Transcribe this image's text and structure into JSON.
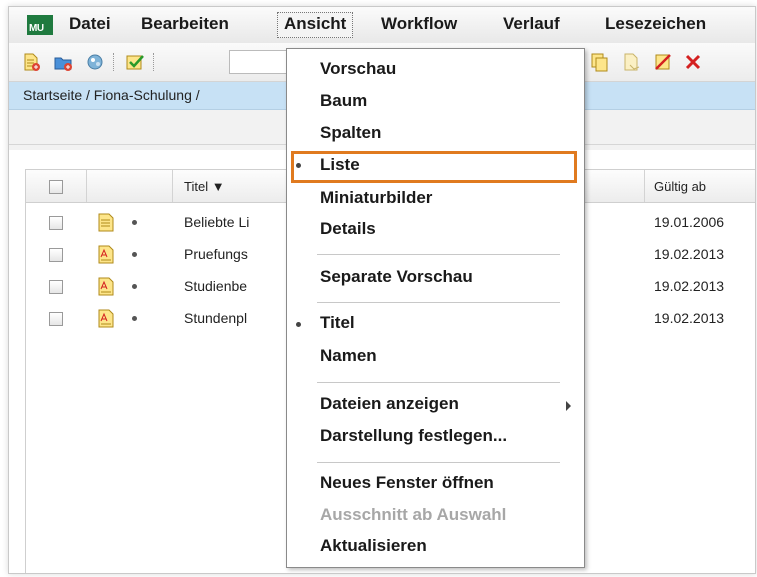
{
  "menubar": {
    "logo": "MU",
    "items": [
      "Datei",
      "Bearbeiten",
      "Ansicht",
      "Workflow",
      "Verlauf",
      "Lesezeichen"
    ]
  },
  "breadcrumb": "Startseite / Fiona-Schulung /",
  "table": {
    "columns": {
      "title": "Titel ▼",
      "valid_from": "Gültig ab"
    },
    "rows": [
      {
        "title": "Beliebte Li",
        "date": "19.01.2006"
      },
      {
        "title": "Pruefungs",
        "date": "19.02.2013"
      },
      {
        "title": "Studienbe",
        "date": "19.02.2013"
      },
      {
        "title": "Stundenpl",
        "date": "19.02.2013"
      }
    ]
  },
  "dropdown": {
    "items": [
      {
        "label": "Vorschau"
      },
      {
        "label": "Baum"
      },
      {
        "label": "Spalten"
      },
      {
        "label": "Liste",
        "selected": true
      },
      {
        "label": "Miniaturbilder"
      },
      {
        "label": "Details"
      },
      {
        "label": "Separate Vorschau"
      },
      {
        "label": "Titel",
        "selected": true
      },
      {
        "label": "Namen"
      },
      {
        "label": "Dateien anzeigen",
        "submenu": true
      },
      {
        "label": "Darstellung festlegen..."
      },
      {
        "label": "Neues Fenster öffnen"
      },
      {
        "label": "Ausschnitt ab Auswahl",
        "disabled": true
      },
      {
        "label": "Aktualisieren"
      }
    ]
  },
  "colors": {
    "highlight": "#e07a1f",
    "breadcrumb_bg": "#c7e1f5",
    "logo": "#1f7a3f"
  }
}
